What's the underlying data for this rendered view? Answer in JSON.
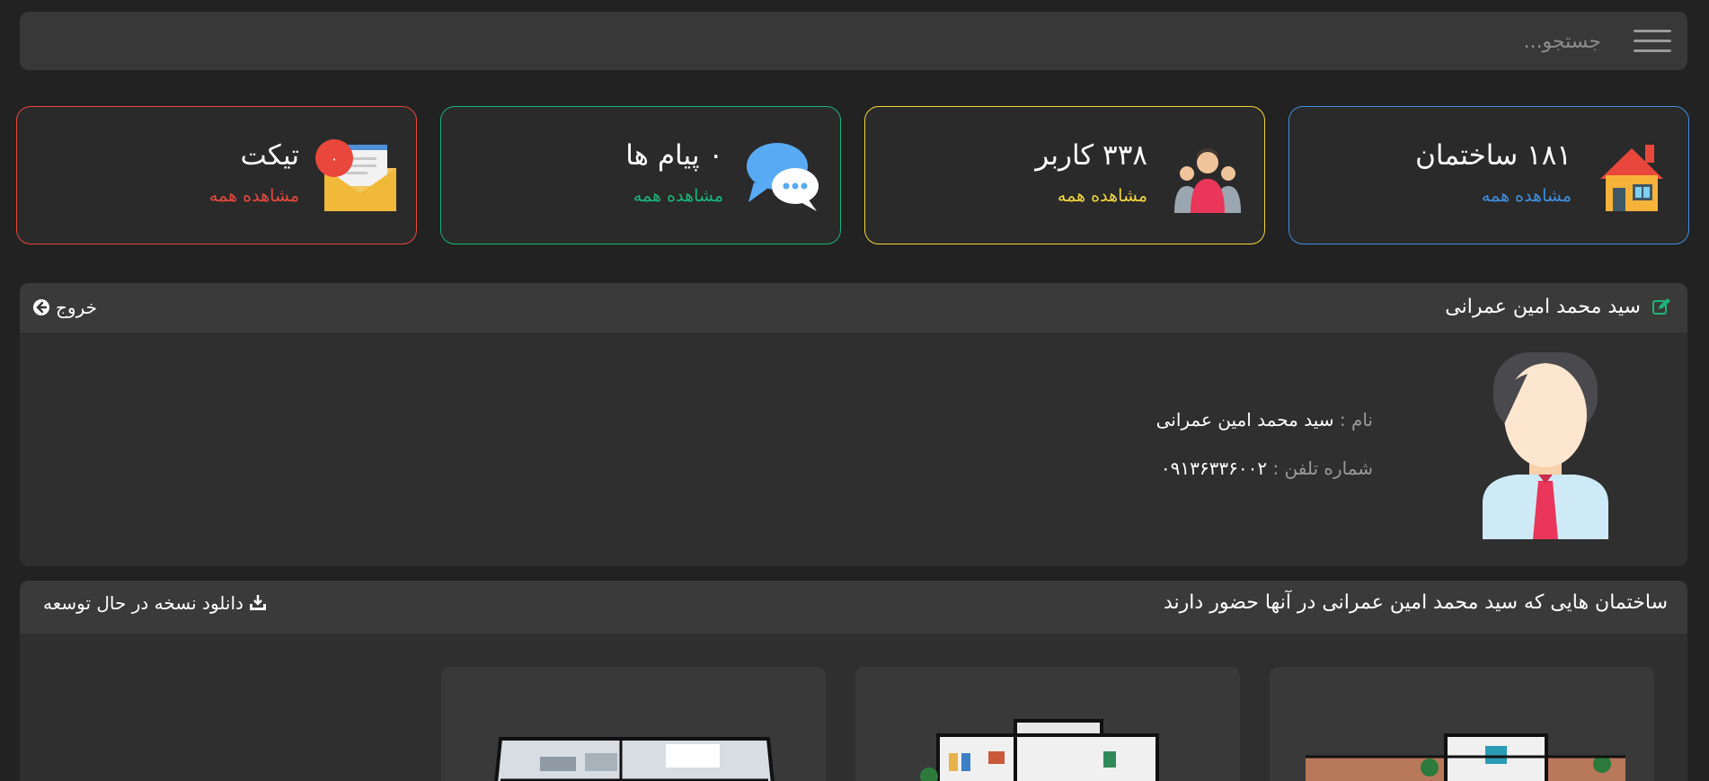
{
  "search": {
    "placeholder": "جستجو..."
  },
  "stats": [
    {
      "title": "۱۸۱ ساختمان",
      "link": "مشاهده همه",
      "color": "#3d8fe0",
      "icon": "house-icon"
    },
    {
      "title": "۳۳۸ کاربر",
      "link": "مشاهده همه",
      "color": "#f2d53c",
      "icon": "users-icon"
    },
    {
      "title": "۰ پیام ها",
      "link": "مشاهده همه",
      "color": "#17b57a",
      "icon": "chat-icon"
    },
    {
      "title": "تیکت",
      "link": "مشاهده همه",
      "color": "#e9473c",
      "icon": "mail-icon",
      "badge": "۰"
    }
  ],
  "profile": {
    "title": "سید محمد امین عمرانی",
    "logout_label": "خروج",
    "name_label": "نام :",
    "name_value": "سید محمد امین عمرانی",
    "phone_label": "شماره تلفن :",
    "phone_value": "۰۹۱۳۶۳۳۶۰۰۲"
  },
  "buildings": {
    "title": "ساختمان هایی که سید محمد امین عمرانی در آنها حضور دارند",
    "download_label": "دانلود نسخه در حال توسعه"
  },
  "colors": {
    "background": "#222222",
    "panel": "#2f2f2f",
    "header": "#3a3a3a",
    "edit_icon": "#1db47c"
  }
}
